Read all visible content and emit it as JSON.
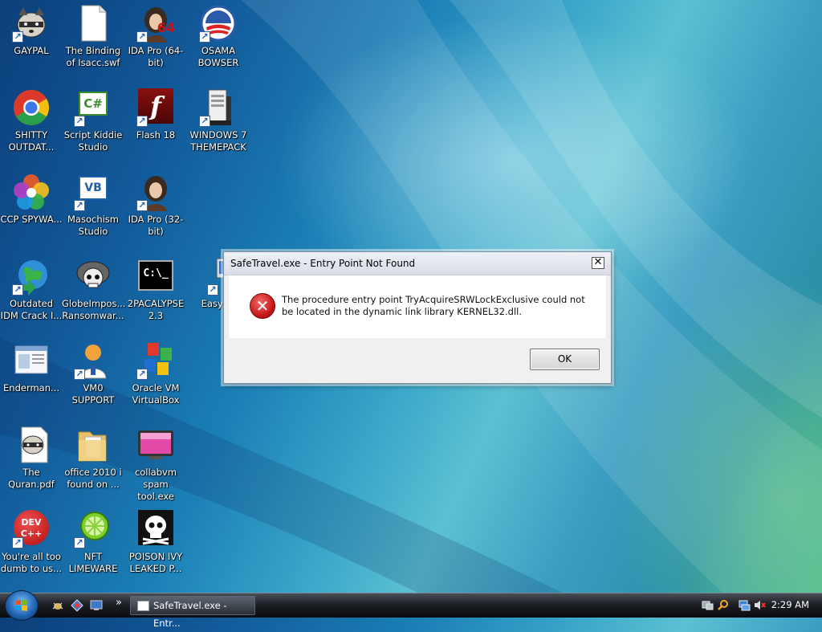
{
  "desktop": {
    "icons": [
      {
        "label": "GAYPAL",
        "icon": "raccoon-icon"
      },
      {
        "label": "The Binding of Isacc.swf",
        "icon": "blank-document-icon"
      },
      {
        "label": "IDA Pro (64-bit)",
        "icon": "ida-portrait-icon",
        "badge": "64"
      },
      {
        "label": "OSAMA BOWSER",
        "icon": "obama-logo-icon"
      },
      {
        "label": "SHITTY OUTDAT...",
        "icon": "chrome-icon"
      },
      {
        "label": "Script Kiddie Studio",
        "icon": "csharp-icon",
        "glyph": "C#"
      },
      {
        "label": "Flash 18",
        "icon": "flash-icon",
        "glyph": "f"
      },
      {
        "label": "WINDOWS 7 THEMEPACK",
        "icon": "winrar-archive-icon"
      },
      {
        "label": "CCP SPYWA...",
        "icon": "colorful-flower-icon"
      },
      {
        "label": "Masochism Studio",
        "icon": "vb-icon",
        "glyph": "VB"
      },
      {
        "label": "IDA Pro (32-bit)",
        "icon": "ida-portrait-icon"
      },
      {
        "label": "Outdated IDM Crack I...",
        "icon": "idm-globe-icon"
      },
      {
        "label": "GlobeImpos... Ransomwar...",
        "icon": "skull-helmet-icon"
      },
      {
        "label": "2PACALYPSE 2.3",
        "icon": "command-prompt-icon",
        "glyph": "C:\\_"
      },
      {
        "label": "EasyBC",
        "icon": "computer-icon"
      },
      {
        "label": "Enderman...",
        "icon": "window-document-icon"
      },
      {
        "label": "VM0 SUPPORT",
        "icon": "support-person-icon"
      },
      {
        "label": "Oracle VM VirtualBox",
        "icon": "virtualbox-icon"
      },
      {
        "label": "The Quran.pdf",
        "icon": "raccoon-document-icon"
      },
      {
        "label": "office 2010 i found on ...",
        "icon": "folder-icon"
      },
      {
        "label": "collabvm spam tool.exe",
        "icon": "tv-screen-icon"
      },
      {
        "label": "You're all too dumb to us...",
        "icon": "dev-cpp-icon",
        "glyph": "DEV C++"
      },
      {
        "label": "NFT LIMEWARE",
        "icon": "limewire-icon"
      },
      {
        "label": "POISON IVY LEAKED P...",
        "icon": "skull-icon"
      }
    ]
  },
  "dialog": {
    "title": "SafeTravel.exe - Entry Point Not Found",
    "close_glyph": "✕",
    "message": "The procedure entry point TryAcquireSRWLockExclusive could not be located in the dynamic link library KERNEL32.dll.",
    "ok_label": "OK",
    "error_glyph": "✕"
  },
  "taskbar": {
    "task_label": "SafeTravel.exe - Entr...",
    "overflow_glyph": "»",
    "clock": "2:29 AM"
  },
  "colors": {
    "error_red": "#c41414",
    "taskbar_dark": "#1c1f24",
    "wallpaper_blue": "#1b7fb6"
  }
}
